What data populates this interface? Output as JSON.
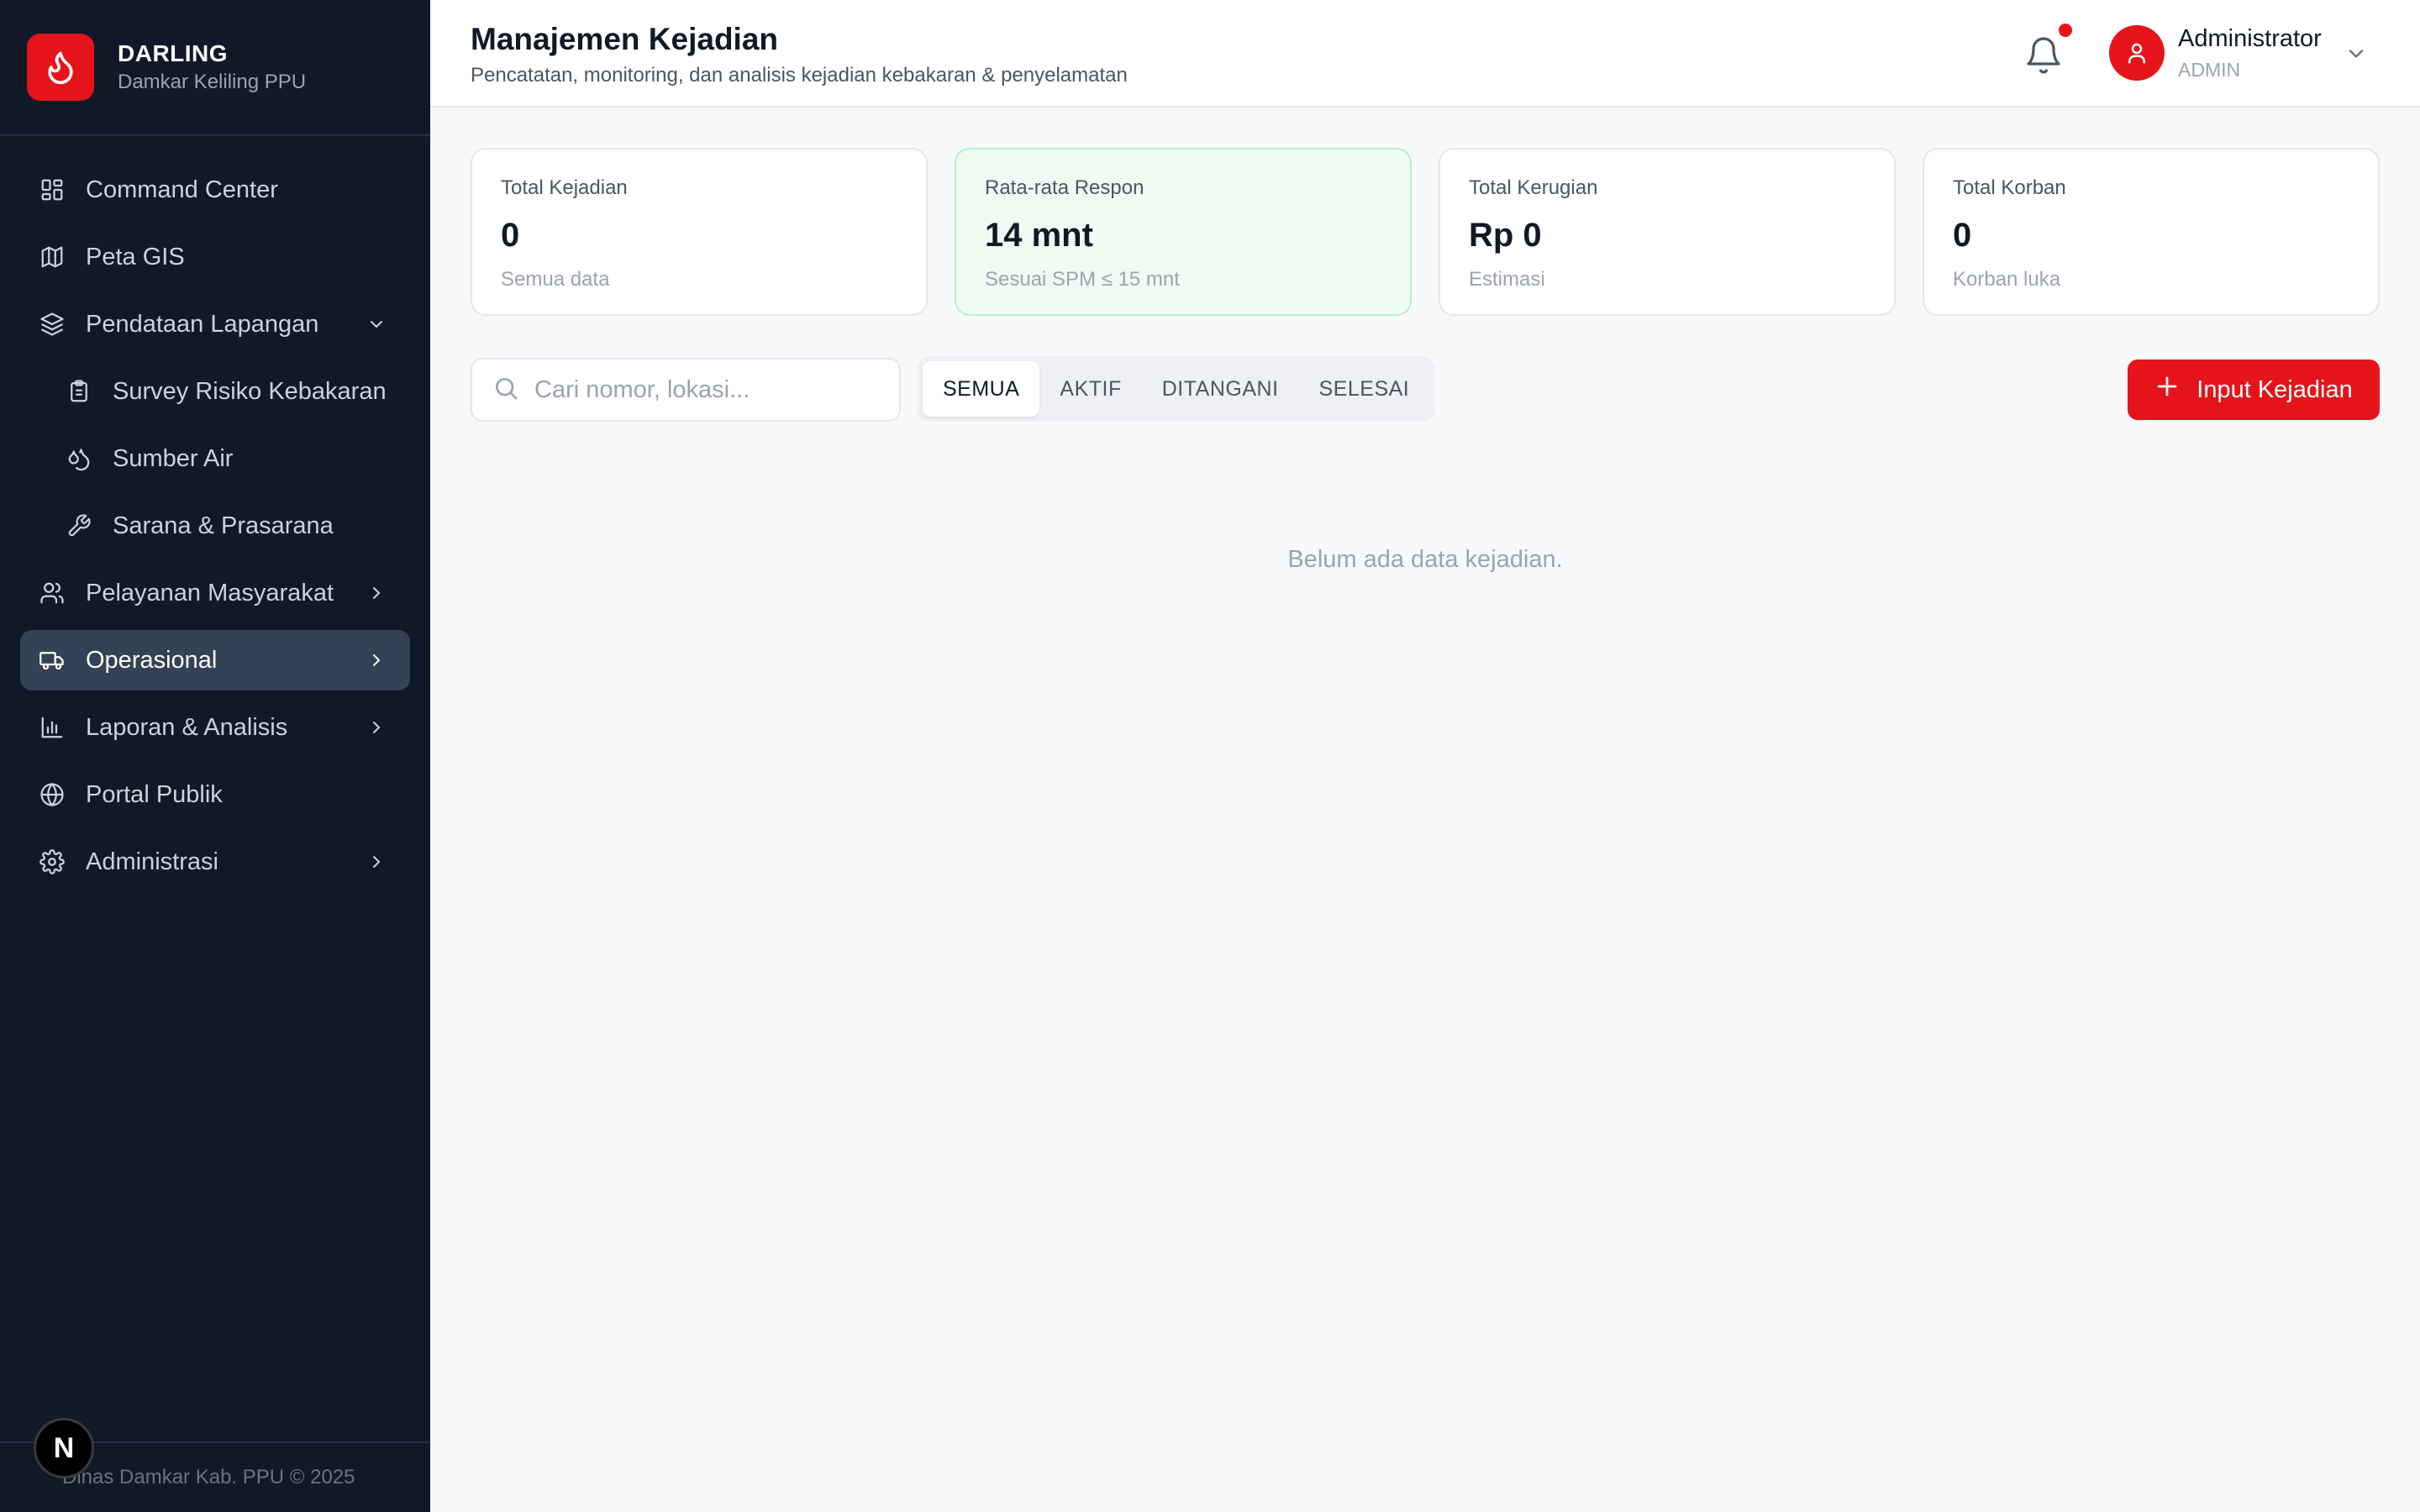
{
  "brand": {
    "title": "DARLING",
    "subtitle": "Damkar Keliling PPU"
  },
  "sidebar": {
    "items": [
      {
        "label": "Command Center",
        "icon": "dashboard-icon"
      },
      {
        "label": "Peta GIS",
        "icon": "map-icon"
      },
      {
        "label": "Pendataan Lapangan",
        "icon": "layers-icon",
        "expanded": true
      },
      {
        "label": "Survey Risiko Kebakaran",
        "icon": "clipboard-icon",
        "sub": true
      },
      {
        "label": "Sumber Air",
        "icon": "droplets-icon",
        "sub": true
      },
      {
        "label": "Sarana & Prasarana",
        "icon": "wrench-icon",
        "sub": true
      },
      {
        "label": "Pelayanan Masyarakat",
        "icon": "users-icon"
      },
      {
        "label": "Operasional",
        "icon": "truck-icon",
        "active": true
      },
      {
        "label": "Laporan & Analisis",
        "icon": "bar-chart-icon"
      },
      {
        "label": "Portal Publik",
        "icon": "globe-icon"
      },
      {
        "label": "Administrasi",
        "icon": "gear-icon"
      }
    ],
    "footer": "Dinas Damkar Kab. PPU © 2025",
    "badge": "N"
  },
  "header": {
    "title": "Manajemen Kejadian",
    "subtitle": "Pencatatan, monitoring, dan analisis kejadian kebakaran & penyelamatan",
    "user": {
      "name": "Administrator",
      "role": "ADMIN"
    }
  },
  "stats": [
    {
      "label": "Total Kejadian",
      "value": "0",
      "note": "Semua data"
    },
    {
      "label": "Rata-rata Respon",
      "value": "14 mnt",
      "note": "Sesuai SPM ≤ 15 mnt"
    },
    {
      "label": "Total Kerugian",
      "value": "Rp 0",
      "note": "Estimasi"
    },
    {
      "label": "Total Korban",
      "value": "0",
      "note": "Korban luka"
    }
  ],
  "search": {
    "placeholder": "Cari nomor, lokasi...",
    "value": ""
  },
  "filters": [
    {
      "label": "SEMUA",
      "active": true
    },
    {
      "label": "AKTIF"
    },
    {
      "label": "DITANGANI"
    },
    {
      "label": "SELESAI"
    }
  ],
  "add_button": "Input Kejadian",
  "empty_message": "Belum ada data kejadian.",
  "colors": {
    "accent": "#e5141a",
    "sidebar_bg": "#111827",
    "active_item": "#354154",
    "success_bg": "#effcf3"
  }
}
